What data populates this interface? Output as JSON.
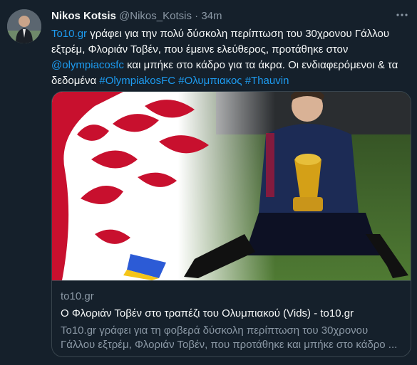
{
  "tweet": {
    "author_name": "Nikos Kotsis",
    "author_handle": "@Nikos_Kotsis",
    "separator": "·",
    "time": "34m",
    "more_icon": "more-dots-icon",
    "text": {
      "part1_link": "To10.gr",
      "part1": " γράφει για την πολύ δύσκολη περίπτωση του 30χρονου Γάλλου εξτρέμ, Φλοριάν Τοβέν, που έμεινε ελεύθερος, προτάθηκε στον ",
      "mention": "@olympiacosfc",
      "part2": "  και μπήκε στο κάδρο για τα άκρα. Οι ενδιαφερόμενοι & τα δεδομένα ",
      "hashtag1": "#OlympiakosFC",
      "hashtag2": "#Ολυμπιακος",
      "hashtag3": "#Thauvin"
    }
  },
  "card": {
    "domain": "to10.gr",
    "title": "Ο Φλοριάν Τοβέν στο τραπέζι του Ολυμπιακού (Vids) - to10.gr",
    "description": "To10.gr γράφει για τη φοβερά δύσκολη περίπτωση του 30χρονου Γάλλου εξτρέμ, Φλοριάν Τοβέν, που προτάθηκε και μπήκε στο κάδρο ..."
  },
  "colors": {
    "background": "#15202b",
    "link": "#1d9bf0",
    "secondary_text": "#8b98a5",
    "border": "#38444d",
    "olympiakos_red": "#c8102e"
  }
}
